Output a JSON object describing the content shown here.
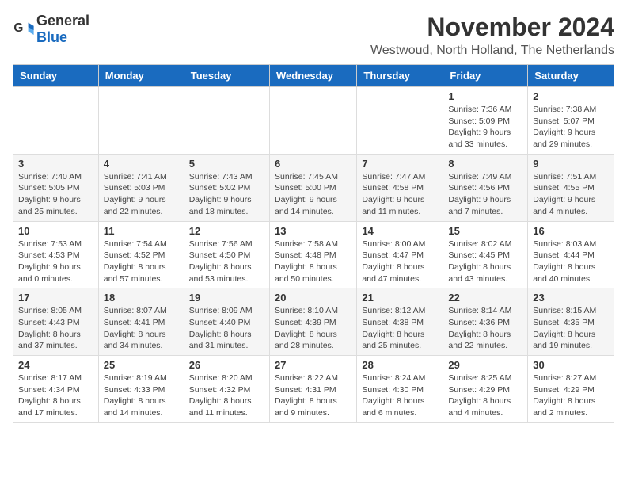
{
  "header": {
    "logo_general": "General",
    "logo_blue": "Blue",
    "month_title": "November 2024",
    "location": "Westwoud, North Holland, The Netherlands"
  },
  "weekdays": [
    "Sunday",
    "Monday",
    "Tuesday",
    "Wednesday",
    "Thursday",
    "Friday",
    "Saturday"
  ],
  "weeks": [
    [
      {
        "day": "",
        "info": ""
      },
      {
        "day": "",
        "info": ""
      },
      {
        "day": "",
        "info": ""
      },
      {
        "day": "",
        "info": ""
      },
      {
        "day": "",
        "info": ""
      },
      {
        "day": "1",
        "info": "Sunrise: 7:36 AM\nSunset: 5:09 PM\nDaylight: 9 hours and 33 minutes."
      },
      {
        "day": "2",
        "info": "Sunrise: 7:38 AM\nSunset: 5:07 PM\nDaylight: 9 hours and 29 minutes."
      }
    ],
    [
      {
        "day": "3",
        "info": "Sunrise: 7:40 AM\nSunset: 5:05 PM\nDaylight: 9 hours and 25 minutes."
      },
      {
        "day": "4",
        "info": "Sunrise: 7:41 AM\nSunset: 5:03 PM\nDaylight: 9 hours and 22 minutes."
      },
      {
        "day": "5",
        "info": "Sunrise: 7:43 AM\nSunset: 5:02 PM\nDaylight: 9 hours and 18 minutes."
      },
      {
        "day": "6",
        "info": "Sunrise: 7:45 AM\nSunset: 5:00 PM\nDaylight: 9 hours and 14 minutes."
      },
      {
        "day": "7",
        "info": "Sunrise: 7:47 AM\nSunset: 4:58 PM\nDaylight: 9 hours and 11 minutes."
      },
      {
        "day": "8",
        "info": "Sunrise: 7:49 AM\nSunset: 4:56 PM\nDaylight: 9 hours and 7 minutes."
      },
      {
        "day": "9",
        "info": "Sunrise: 7:51 AM\nSunset: 4:55 PM\nDaylight: 9 hours and 4 minutes."
      }
    ],
    [
      {
        "day": "10",
        "info": "Sunrise: 7:53 AM\nSunset: 4:53 PM\nDaylight: 9 hours and 0 minutes."
      },
      {
        "day": "11",
        "info": "Sunrise: 7:54 AM\nSunset: 4:52 PM\nDaylight: 8 hours and 57 minutes."
      },
      {
        "day": "12",
        "info": "Sunrise: 7:56 AM\nSunset: 4:50 PM\nDaylight: 8 hours and 53 minutes."
      },
      {
        "day": "13",
        "info": "Sunrise: 7:58 AM\nSunset: 4:48 PM\nDaylight: 8 hours and 50 minutes."
      },
      {
        "day": "14",
        "info": "Sunrise: 8:00 AM\nSunset: 4:47 PM\nDaylight: 8 hours and 47 minutes."
      },
      {
        "day": "15",
        "info": "Sunrise: 8:02 AM\nSunset: 4:45 PM\nDaylight: 8 hours and 43 minutes."
      },
      {
        "day": "16",
        "info": "Sunrise: 8:03 AM\nSunset: 4:44 PM\nDaylight: 8 hours and 40 minutes."
      }
    ],
    [
      {
        "day": "17",
        "info": "Sunrise: 8:05 AM\nSunset: 4:43 PM\nDaylight: 8 hours and 37 minutes."
      },
      {
        "day": "18",
        "info": "Sunrise: 8:07 AM\nSunset: 4:41 PM\nDaylight: 8 hours and 34 minutes."
      },
      {
        "day": "19",
        "info": "Sunrise: 8:09 AM\nSunset: 4:40 PM\nDaylight: 8 hours and 31 minutes."
      },
      {
        "day": "20",
        "info": "Sunrise: 8:10 AM\nSunset: 4:39 PM\nDaylight: 8 hours and 28 minutes."
      },
      {
        "day": "21",
        "info": "Sunrise: 8:12 AM\nSunset: 4:38 PM\nDaylight: 8 hours and 25 minutes."
      },
      {
        "day": "22",
        "info": "Sunrise: 8:14 AM\nSunset: 4:36 PM\nDaylight: 8 hours and 22 minutes."
      },
      {
        "day": "23",
        "info": "Sunrise: 8:15 AM\nSunset: 4:35 PM\nDaylight: 8 hours and 19 minutes."
      }
    ],
    [
      {
        "day": "24",
        "info": "Sunrise: 8:17 AM\nSunset: 4:34 PM\nDaylight: 8 hours and 17 minutes."
      },
      {
        "day": "25",
        "info": "Sunrise: 8:19 AM\nSunset: 4:33 PM\nDaylight: 8 hours and 14 minutes."
      },
      {
        "day": "26",
        "info": "Sunrise: 8:20 AM\nSunset: 4:32 PM\nDaylight: 8 hours and 11 minutes."
      },
      {
        "day": "27",
        "info": "Sunrise: 8:22 AM\nSunset: 4:31 PM\nDaylight: 8 hours and 9 minutes."
      },
      {
        "day": "28",
        "info": "Sunrise: 8:24 AM\nSunset: 4:30 PM\nDaylight: 8 hours and 6 minutes."
      },
      {
        "day": "29",
        "info": "Sunrise: 8:25 AM\nSunset: 4:29 PM\nDaylight: 8 hours and 4 minutes."
      },
      {
        "day": "30",
        "info": "Sunrise: 8:27 AM\nSunset: 4:29 PM\nDaylight: 8 hours and 2 minutes."
      }
    ]
  ]
}
